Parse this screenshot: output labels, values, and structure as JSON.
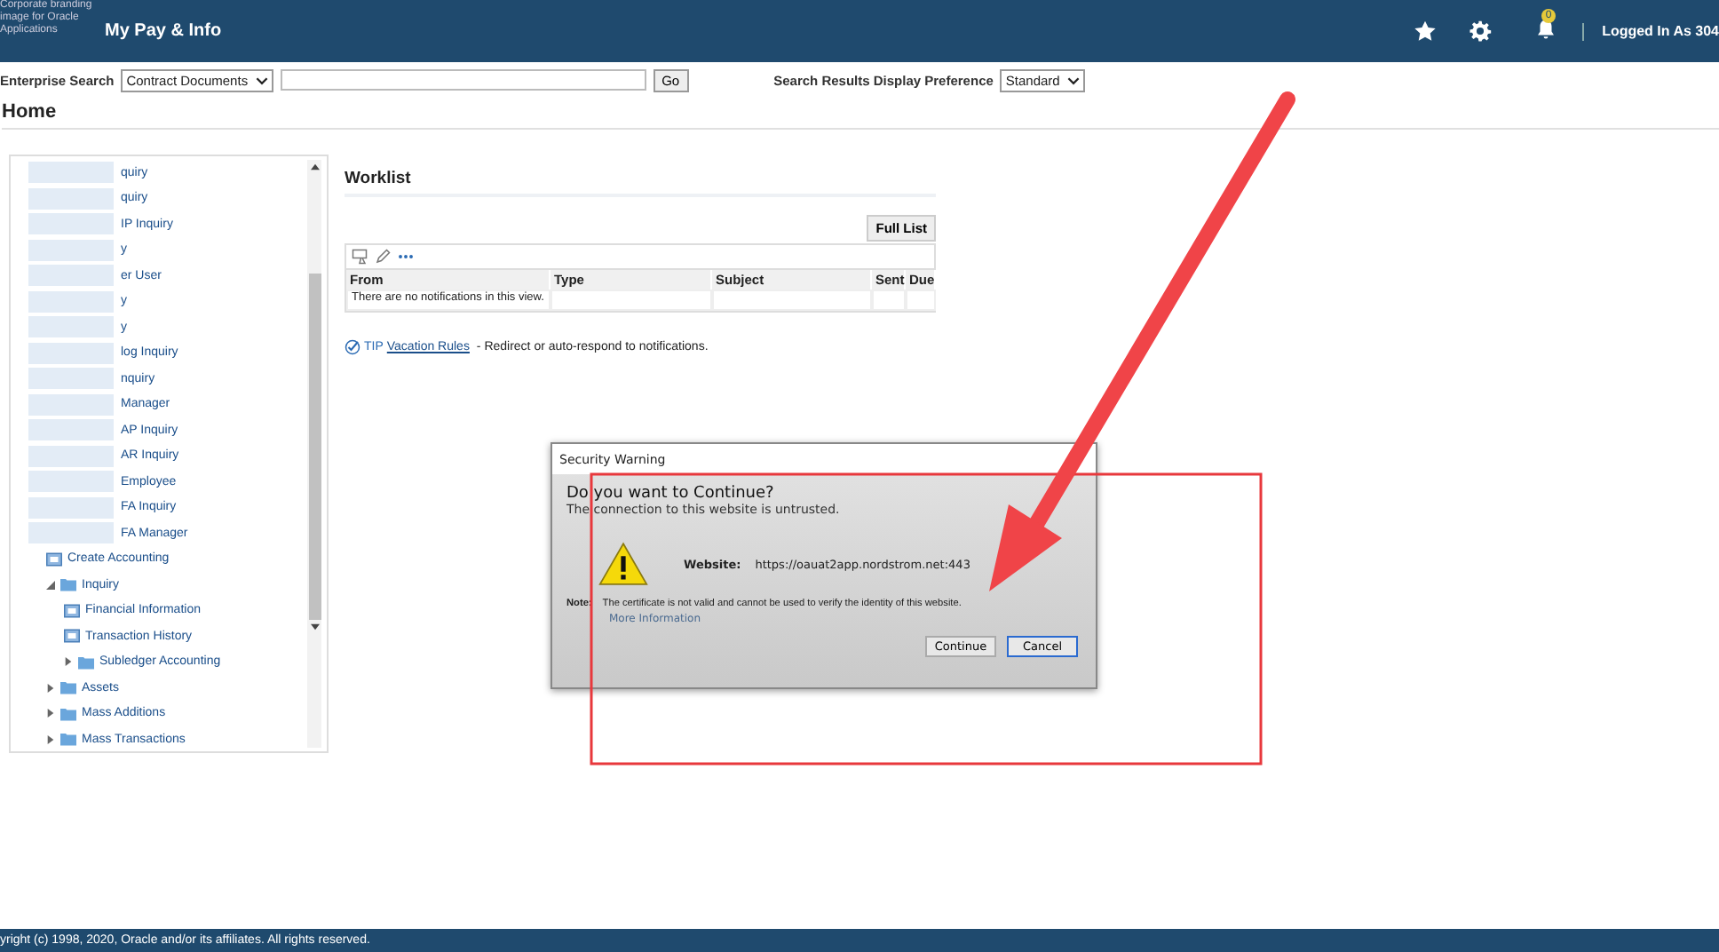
{
  "header": {
    "logo_alt": "Corporate branding image for Oracle Applications",
    "title": "My Pay & Info",
    "notification_count": "0",
    "user": "Logged In As 304"
  },
  "search": {
    "label": "Enterprise Search",
    "category": "Contract Documents",
    "button": "Go",
    "preference_label": "Search Results Display Preference",
    "preference": "Standard"
  },
  "page_title": "Home",
  "tree": [
    {
      "kind": "redacted",
      "label": "quiry"
    },
    {
      "kind": "redacted",
      "label": "quiry"
    },
    {
      "kind": "redacted",
      "label": "IP Inquiry"
    },
    {
      "kind": "redacted",
      "label": "y"
    },
    {
      "kind": "redacted",
      "label": "er User"
    },
    {
      "kind": "redacted",
      "label": "y"
    },
    {
      "kind": "redacted",
      "label": "y"
    },
    {
      "kind": "redacted",
      "label": "log Inquiry"
    },
    {
      "kind": "redacted",
      "label": "nquiry"
    },
    {
      "kind": "redacted",
      "label": "Manager"
    },
    {
      "kind": "redacted",
      "label": "AP Inquiry"
    },
    {
      "kind": "redacted",
      "label": "AR Inquiry"
    },
    {
      "kind": "redacted",
      "label": "Employee"
    },
    {
      "kind": "redacted",
      "label": "FA Inquiry"
    },
    {
      "kind": "redacted",
      "label": "FA Manager"
    },
    {
      "kind": "page",
      "label": "Create Accounting"
    },
    {
      "kind": "folder",
      "label": "Inquiry",
      "expanded": true,
      "children": [
        {
          "kind": "page",
          "label": "Financial Information"
        },
        {
          "kind": "page",
          "label": "Transaction History"
        },
        {
          "kind": "folder",
          "label": "Subledger Accounting",
          "expanded": false
        }
      ]
    },
    {
      "kind": "folder",
      "label": "Assets",
      "expanded": false
    },
    {
      "kind": "folder",
      "label": "Mass Additions",
      "expanded": false
    },
    {
      "kind": "folder",
      "label": "Mass Transactions",
      "expanded": false
    }
  ],
  "worklist": {
    "title": "Worklist",
    "full_list": "Full List",
    "columns": [
      "From",
      "Type",
      "Subject",
      "Sent",
      "Due"
    ],
    "empty_message": "There are no notifications in this view.",
    "tip_label": "TIP",
    "tip_link": "Vacation Rules",
    "tip_text": " - Redirect or auto-respond to notifications."
  },
  "dialog": {
    "title": "Security Warning",
    "heading": "Do you want to Continue?",
    "subheading": "The connection to this website is untrusted.",
    "website_label": "Website:",
    "website": "https://oauat2app.nordstrom.net:443",
    "note_label": "Note:",
    "note": "The certificate is not valid and cannot be used to verify the identity of this website.",
    "more_info": "More Information",
    "buttons": [
      {
        "label": "Continue",
        "selected": false
      },
      {
        "label": "Cancel",
        "selected": true
      }
    ]
  },
  "footer": "yright (c) 1998, 2020, Oracle and/or its affiliates. All rights reserved."
}
